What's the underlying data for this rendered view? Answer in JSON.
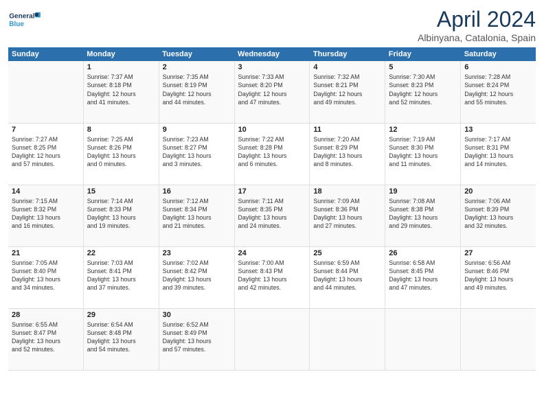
{
  "logo": {
    "text1": "General",
    "text2": "Blue"
  },
  "title": "April 2024",
  "subtitle": "Albinyana, Catalonia, Spain",
  "headers": [
    "Sunday",
    "Monday",
    "Tuesday",
    "Wednesday",
    "Thursday",
    "Friday",
    "Saturday"
  ],
  "weeks": [
    [
      {
        "day": "",
        "info": ""
      },
      {
        "day": "1",
        "info": "Sunrise: 7:37 AM\nSunset: 8:18 PM\nDaylight: 12 hours\nand 41 minutes."
      },
      {
        "day": "2",
        "info": "Sunrise: 7:35 AM\nSunset: 8:19 PM\nDaylight: 12 hours\nand 44 minutes."
      },
      {
        "day": "3",
        "info": "Sunrise: 7:33 AM\nSunset: 8:20 PM\nDaylight: 12 hours\nand 47 minutes."
      },
      {
        "day": "4",
        "info": "Sunrise: 7:32 AM\nSunset: 8:21 PM\nDaylight: 12 hours\nand 49 minutes."
      },
      {
        "day": "5",
        "info": "Sunrise: 7:30 AM\nSunset: 8:23 PM\nDaylight: 12 hours\nand 52 minutes."
      },
      {
        "day": "6",
        "info": "Sunrise: 7:28 AM\nSunset: 8:24 PM\nDaylight: 12 hours\nand 55 minutes."
      }
    ],
    [
      {
        "day": "7",
        "info": "Sunrise: 7:27 AM\nSunset: 8:25 PM\nDaylight: 12 hours\nand 57 minutes."
      },
      {
        "day": "8",
        "info": "Sunrise: 7:25 AM\nSunset: 8:26 PM\nDaylight: 13 hours\nand 0 minutes."
      },
      {
        "day": "9",
        "info": "Sunrise: 7:23 AM\nSunset: 8:27 PM\nDaylight: 13 hours\nand 3 minutes."
      },
      {
        "day": "10",
        "info": "Sunrise: 7:22 AM\nSunset: 8:28 PM\nDaylight: 13 hours\nand 6 minutes."
      },
      {
        "day": "11",
        "info": "Sunrise: 7:20 AM\nSunset: 8:29 PM\nDaylight: 13 hours\nand 8 minutes."
      },
      {
        "day": "12",
        "info": "Sunrise: 7:19 AM\nSunset: 8:30 PM\nDaylight: 13 hours\nand 11 minutes."
      },
      {
        "day": "13",
        "info": "Sunrise: 7:17 AM\nSunset: 8:31 PM\nDaylight: 13 hours\nand 14 minutes."
      }
    ],
    [
      {
        "day": "14",
        "info": "Sunrise: 7:15 AM\nSunset: 8:32 PM\nDaylight: 13 hours\nand 16 minutes."
      },
      {
        "day": "15",
        "info": "Sunrise: 7:14 AM\nSunset: 8:33 PM\nDaylight: 13 hours\nand 19 minutes."
      },
      {
        "day": "16",
        "info": "Sunrise: 7:12 AM\nSunset: 8:34 PM\nDaylight: 13 hours\nand 21 minutes."
      },
      {
        "day": "17",
        "info": "Sunrise: 7:11 AM\nSunset: 8:35 PM\nDaylight: 13 hours\nand 24 minutes."
      },
      {
        "day": "18",
        "info": "Sunrise: 7:09 AM\nSunset: 8:36 PM\nDaylight: 13 hours\nand 27 minutes."
      },
      {
        "day": "19",
        "info": "Sunrise: 7:08 AM\nSunset: 8:38 PM\nDaylight: 13 hours\nand 29 minutes."
      },
      {
        "day": "20",
        "info": "Sunrise: 7:06 AM\nSunset: 8:39 PM\nDaylight: 13 hours\nand 32 minutes."
      }
    ],
    [
      {
        "day": "21",
        "info": "Sunrise: 7:05 AM\nSunset: 8:40 PM\nDaylight: 13 hours\nand 34 minutes."
      },
      {
        "day": "22",
        "info": "Sunrise: 7:03 AM\nSunset: 8:41 PM\nDaylight: 13 hours\nand 37 minutes."
      },
      {
        "day": "23",
        "info": "Sunrise: 7:02 AM\nSunset: 8:42 PM\nDaylight: 13 hours\nand 39 minutes."
      },
      {
        "day": "24",
        "info": "Sunrise: 7:00 AM\nSunset: 8:43 PM\nDaylight: 13 hours\nand 42 minutes."
      },
      {
        "day": "25",
        "info": "Sunrise: 6:59 AM\nSunset: 8:44 PM\nDaylight: 13 hours\nand 44 minutes."
      },
      {
        "day": "26",
        "info": "Sunrise: 6:58 AM\nSunset: 8:45 PM\nDaylight: 13 hours\nand 47 minutes."
      },
      {
        "day": "27",
        "info": "Sunrise: 6:56 AM\nSunset: 8:46 PM\nDaylight: 13 hours\nand 49 minutes."
      }
    ],
    [
      {
        "day": "28",
        "info": "Sunrise: 6:55 AM\nSunset: 8:47 PM\nDaylight: 13 hours\nand 52 minutes."
      },
      {
        "day": "29",
        "info": "Sunrise: 6:54 AM\nSunset: 8:48 PM\nDaylight: 13 hours\nand 54 minutes."
      },
      {
        "day": "30",
        "info": "Sunrise: 6:52 AM\nSunset: 8:49 PM\nDaylight: 13 hours\nand 57 minutes."
      },
      {
        "day": "",
        "info": ""
      },
      {
        "day": "",
        "info": ""
      },
      {
        "day": "",
        "info": ""
      },
      {
        "day": "",
        "info": ""
      }
    ]
  ]
}
